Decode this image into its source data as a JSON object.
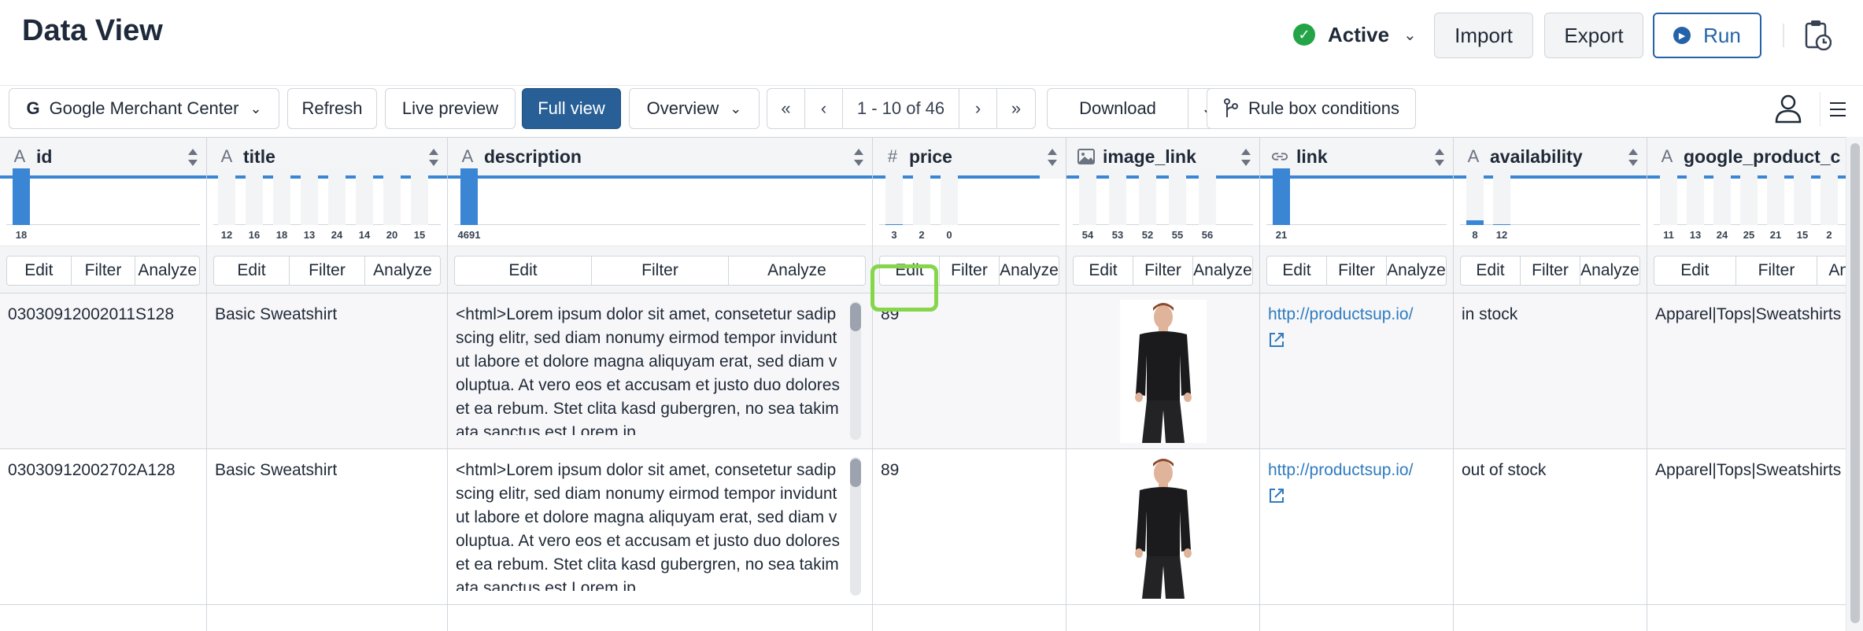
{
  "header": {
    "title": "Data View",
    "status": "Active",
    "import_label": "Import",
    "export_label": "Export",
    "run_label": "Run"
  },
  "toolbar": {
    "source": "Google Merchant Center",
    "source_icon": "G",
    "refresh": "Refresh",
    "live_preview": "Live preview",
    "full_view": "Full view",
    "overview": "Overview",
    "pager": {
      "first": "«",
      "prev": "‹",
      "range": "1 - 10 of 46",
      "next": "›",
      "last": "»"
    },
    "download": "Download",
    "rule_box": "Rule box conditions"
  },
  "actions": {
    "edit": "Edit",
    "filter": "Filter",
    "analyze": "Analyze"
  },
  "columns": [
    {
      "name": "id",
      "type_icon": "A",
      "hist": [
        {
          "label": "18",
          "fill": 1.0
        }
      ]
    },
    {
      "name": "title",
      "type_icon": "A",
      "hist": [
        {
          "label": "12",
          "fill": 0.0
        },
        {
          "label": "16",
          "fill": 0.0
        },
        {
          "label": "18",
          "fill": 0.0
        },
        {
          "label": "13",
          "fill": 0.0
        },
        {
          "label": "24",
          "fill": 0.0
        },
        {
          "label": "14",
          "fill": 0.0
        },
        {
          "label": "20",
          "fill": 0.0
        },
        {
          "label": "15",
          "fill": 0.0
        }
      ]
    },
    {
      "name": "description",
      "type_icon": "A",
      "hist": [
        {
          "label": "4691",
          "fill": 1.0
        }
      ]
    },
    {
      "name": "price",
      "type_icon": "#",
      "hist": [
        {
          "label": "3",
          "fill": 0.02
        },
        {
          "label": "2",
          "fill": 0.0
        },
        {
          "label": "0",
          "fill": 0.0
        }
      ]
    },
    {
      "name": "image_link",
      "type_icon": "image",
      "hist": [
        {
          "label": "54",
          "fill": 0.0
        },
        {
          "label": "53",
          "fill": 0.0
        },
        {
          "label": "52",
          "fill": 0.0
        },
        {
          "label": "55",
          "fill": 0.0
        },
        {
          "label": "56",
          "fill": 0.0
        }
      ]
    },
    {
      "name": "link",
      "type_icon": "link",
      "hist": [
        {
          "label": "21",
          "fill": 1.0
        }
      ]
    },
    {
      "name": "availability",
      "type_icon": "A",
      "hist": [
        {
          "label": "8",
          "fill": 0.08
        },
        {
          "label": "12",
          "fill": 0.02
        }
      ]
    },
    {
      "name": "google_product_c",
      "type_icon": "A",
      "hist": [
        {
          "label": "11",
          "fill": 0.0
        },
        {
          "label": "13",
          "fill": 0.0
        },
        {
          "label": "24",
          "fill": 0.0
        },
        {
          "label": "25",
          "fill": 0.0
        },
        {
          "label": "21",
          "fill": 0.0
        },
        {
          "label": "15",
          "fill": 0.0
        },
        {
          "label": "2",
          "fill": 0.0
        }
      ]
    }
  ],
  "rows": [
    {
      "id": "03030912002011S128",
      "title": "Basic Sweatshirt",
      "description": "<html>Lorem ipsum dolor sit amet, consetetur sadipscing elitr, sed diam nonumy eirmod tempor invidunt ut labore et dolore magna aliquyam erat, sed diam voluptua. At vero eos et accusam et justo duo dolores et ea rebum. Stet clita kasd gubergren, no sea takimata sanctus est Lorem ip",
      "price": "89",
      "link": "http://productsup.io/",
      "availability": "in stock",
      "google_product_category": "Apparel|Tops|Sweatshirts"
    },
    {
      "id": "03030912002702A128",
      "title": "Basic Sweatshirt",
      "description": "<html>Lorem ipsum dolor sit amet, consetetur sadipscing elitr, sed diam nonumy eirmod tempor invidunt ut labore et dolore magna aliquyam erat, sed diam voluptua. At vero eos et accusam et justo duo dolores et ea rebum. Stet clita kasd gubergren, no sea takimata sanctus est Lorem ip",
      "price": "89",
      "link": "http://productsup.io/",
      "availability": "out of stock",
      "google_product_category": "Apparel|Tops|Sweatshirts"
    }
  ],
  "colors": {
    "accent": "#275f96",
    "bar": "#3a86d4",
    "active": "#22a447",
    "highlight": "#86d64b",
    "link": "#2f7bbf"
  }
}
